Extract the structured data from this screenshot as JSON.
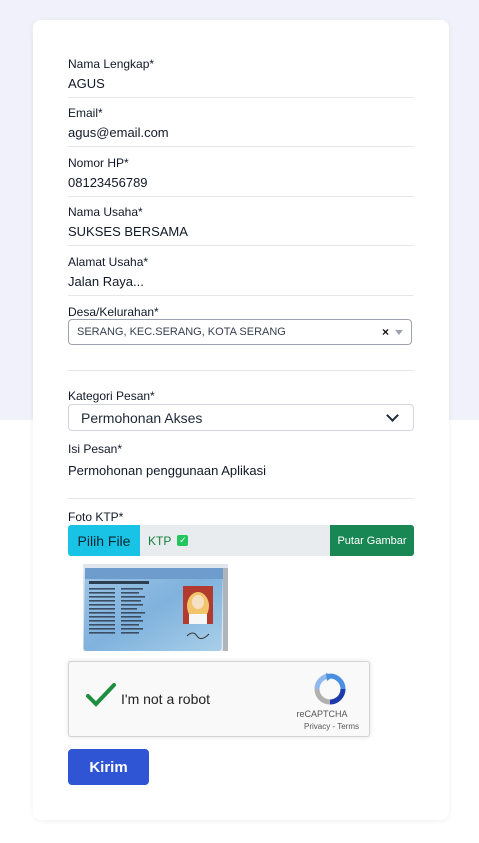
{
  "form": {
    "nama_lengkap": {
      "label": "Nama Lengkap*",
      "value": "AGUS"
    },
    "email": {
      "label": "Email*",
      "value": "agus@email.com"
    },
    "nomor_hp": {
      "label": "Nomor HP*",
      "value": "08123456789"
    },
    "nama_usaha": {
      "label": "Nama Usaha*",
      "value": "SUKSES BERSAMA"
    },
    "alamat_usaha": {
      "label": "Alamat Usaha*",
      "value": "Jalan Raya..."
    },
    "desa": {
      "label": "Desa/Kelurahan*",
      "value": "SERANG, KEC.SERANG, KOTA SERANG",
      "clear": "×"
    },
    "kategori": {
      "label": "Kategori Pesan*",
      "value": "Permohonan Akses"
    },
    "isi_pesan": {
      "label": "Isi Pesan*",
      "value": "Permohonan penggunaan Aplikasi"
    },
    "foto_ktp": {
      "label": "Foto KTP*",
      "pick_label": "Pilih File",
      "file_name": "KTP",
      "file_check": "✓",
      "rotate_label": "Putar Gambar"
    },
    "recaptcha": {
      "text": "I'm not a robot",
      "brand": "reCAPTCHA",
      "privacy": "Privacy",
      "separator": " - ",
      "terms": "Terms"
    },
    "submit_label": "Kirim"
  },
  "colors": {
    "primary": "#2f55d4",
    "file_button": "#19c3e6",
    "rotate_button": "#198754",
    "check_green": "#22c55e"
  }
}
